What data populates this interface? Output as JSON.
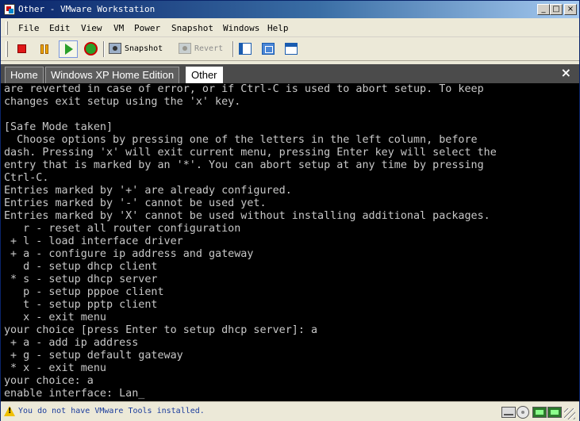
{
  "window": {
    "title": "Other - VMware Workstation"
  },
  "menu": [
    "File",
    "Edit",
    "View",
    "VM",
    "Power",
    "Snapshot",
    "Windows",
    "Help"
  ],
  "toolbar": {
    "snapshot_label": "Snapshot",
    "revert_label": "Revert"
  },
  "tabs": [
    "Home",
    "Windows XP Home Edition",
    "Other"
  ],
  "active_tab": "Other",
  "console_lines": [
    "are reverted in case of error, or if Ctrl-C is used to abort setup. To keep",
    "changes exit setup using the 'x' key.",
    "",
    "[Safe Mode taken]",
    "  Choose options by pressing one of the letters in the left column, before",
    "dash. Pressing 'x' will exit current menu, pressing Enter key will select the",
    "entry that is marked by an '*'. You can abort setup at any time by pressing",
    "Ctrl-C.",
    "Entries marked by '+' are already configured.",
    "Entries marked by '-' cannot be used yet.",
    "Entries marked by 'X' cannot be used without installing additional packages.",
    "   r - reset all router configuration",
    " + l - load interface driver",
    " + a - configure ip address and gateway",
    "   d - setup dhcp client",
    " * s - setup dhcp server",
    "   p - setup pppoe client",
    "   t - setup pptp client",
    "   x - exit menu",
    "your choice [press Enter to setup dhcp server]: a",
    " + a - add ip address",
    " + g - setup default gateway",
    " * x - exit menu",
    "your choice: a",
    "enable interface: Lan_"
  ],
  "status": {
    "message": "You do not have VMware Tools installed."
  },
  "colors": {
    "console_bg": "#000000",
    "console_fg": "#c8c8c8",
    "title_start": "#0a246a",
    "title_end": "#a6caf0",
    "status_text": "#1a3c9c"
  },
  "icons": {
    "title": "vmware-app-icon",
    "toolbar": [
      "power-off-icon",
      "suspend-icon",
      "power-on-icon",
      "reset-icon",
      "snapshot-icon",
      "revert-icon",
      "quick-switch-icon",
      "fullscreen-icon",
      "summary-view-icon"
    ],
    "status": [
      "warning-icon",
      "hard-disk-icon",
      "cdrom-icon",
      "network-adapter-icon",
      "network-adapter-icon"
    ]
  }
}
